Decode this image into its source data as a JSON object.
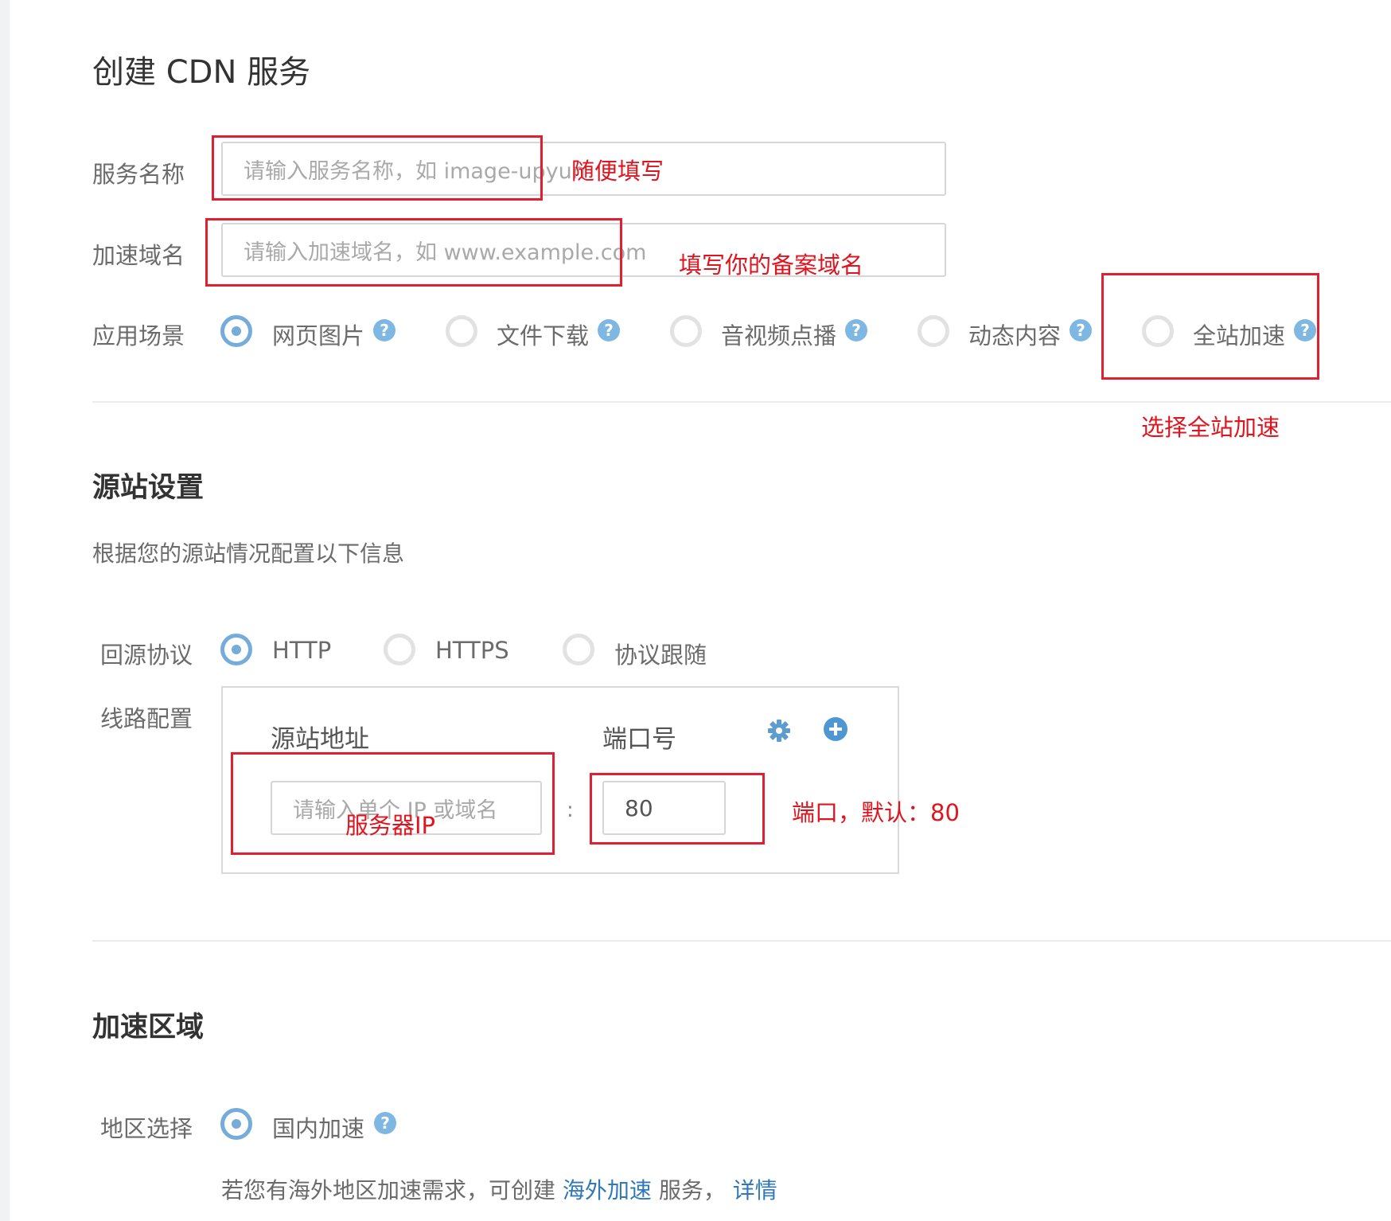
{
  "page": {
    "title": "创建 CDN 服务"
  },
  "basic": {
    "service_name_label": "服务名称",
    "service_name_placeholder": "请输入服务名称，如 image-upyun",
    "domain_label": "加速域名",
    "domain_placeholder": "请输入加速域名，如 www.example.com",
    "scene_label": "应用场景",
    "scenes": [
      {
        "label": "网页图片",
        "selected": true
      },
      {
        "label": "文件下载",
        "selected": false
      },
      {
        "label": "音视频点播",
        "selected": false
      },
      {
        "label": "动态内容",
        "selected": false
      },
      {
        "label": "全站加速",
        "selected": false
      }
    ],
    "help_glyph": "?"
  },
  "origin": {
    "title": "源站设置",
    "desc": "根据您的源站情况配置以下信息",
    "protocol_label": "回源协议",
    "protocols": [
      {
        "label": "HTTP",
        "selected": true
      },
      {
        "label": "HTTPS",
        "selected": false
      },
      {
        "label": "协议跟随",
        "selected": false
      }
    ],
    "route_label": "线路配置",
    "col_address": "源站地址",
    "col_port": "端口号",
    "address_placeholder": "请输入单个 IP 或域名",
    "separator": ":",
    "port_value": "80"
  },
  "region": {
    "title": "加速区域",
    "label": "地区选择",
    "option": "国内加速",
    "note_prefix": "若您有海外地区加速需求，可创建",
    "note_link": "海外加速",
    "note_mid": "服务，",
    "note_detail": "详情"
  },
  "annotations": {
    "service_name": "随便填写",
    "domain": "填写你的备案域名",
    "scene": "选择全站加速",
    "server_ip": "服务器IP",
    "port": "端口，默认：80"
  },
  "colors": {
    "accent": "#76acd9",
    "annotation": "#e0141e",
    "link": "#2f79b8"
  }
}
